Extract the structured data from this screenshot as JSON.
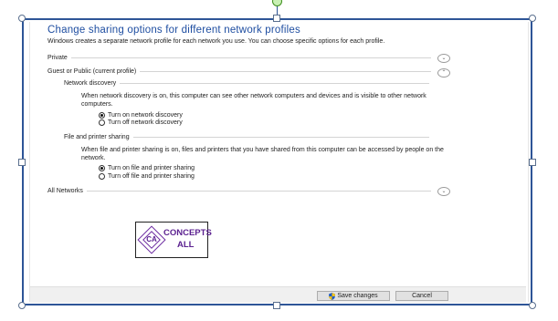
{
  "dialog": {
    "title": "Change sharing options for different network profiles",
    "intro": "Windows creates a separate network profile for each network you use. You can choose specific options for each profile."
  },
  "profiles": {
    "private": {
      "label": "Private"
    },
    "guest": {
      "label": "Guest or Public (current profile)",
      "discovery": {
        "heading": "Network discovery",
        "description": "When network discovery is on, this computer can see other network computers and devices and is visible to other network computers.",
        "options": [
          "Turn on network discovery",
          "Turn off network discovery"
        ],
        "selected": 0
      },
      "sharing": {
        "heading": "File and printer sharing",
        "description": "When file and printer sharing is on, files and printers that you have shared from this computer can be accessed by people on the network.",
        "options": [
          "Turn on file and printer sharing",
          "Turn off file and printer sharing"
        ],
        "selected": 0
      }
    },
    "all": {
      "label": "All Networks"
    }
  },
  "logo": {
    "mark": "CA",
    "line1": "CONCEPTS",
    "line2": "ALL"
  },
  "footer": {
    "save_label": "Save changes",
    "cancel_label": "Cancel"
  },
  "icons": {
    "expand": "chevron-down-icon",
    "collapse": "chevron-up-icon",
    "shield": "uac-shield-icon"
  },
  "colors": {
    "title": "#1f4ea1",
    "frame": "#2e5597",
    "logo": "#5a1f8f"
  }
}
